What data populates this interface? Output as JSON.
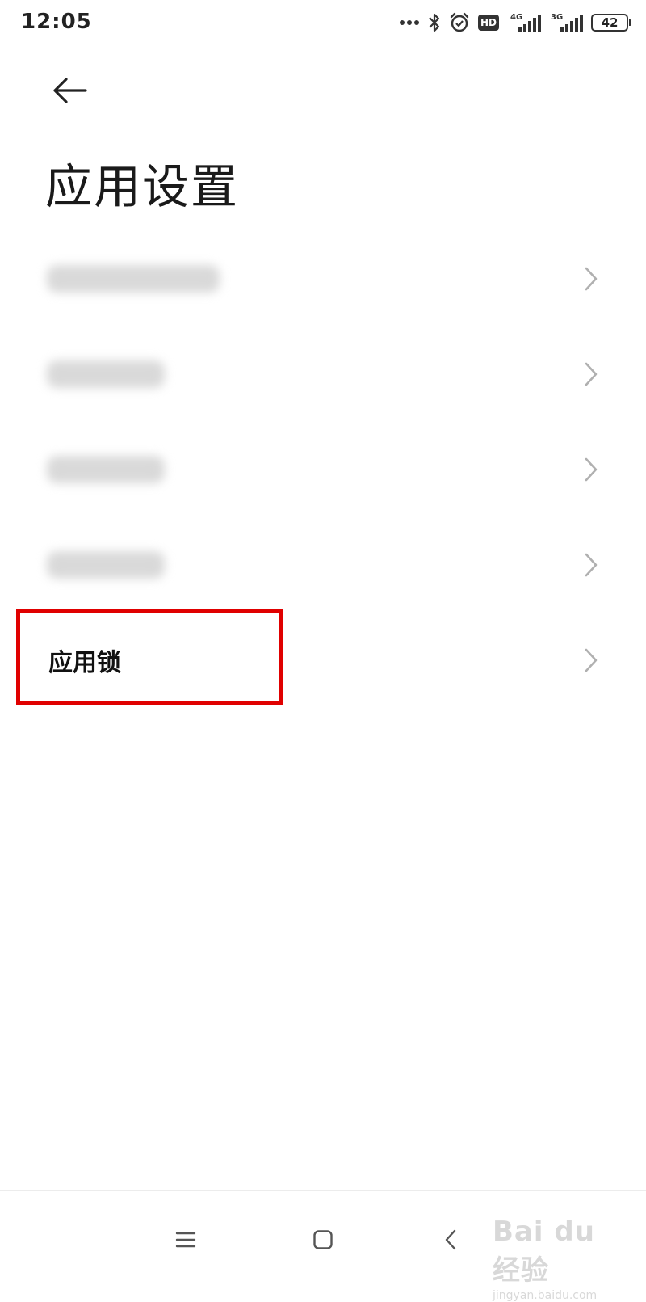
{
  "status_bar": {
    "time": "12:05",
    "network_4g": "4G",
    "network_3g": "3G",
    "hd": "HD",
    "battery": "42",
    "icons": [
      "more-dots-icon",
      "bluetooth-icon",
      "alarm-icon",
      "hd-icon",
      "signal-4g-icon",
      "signal-3g-icon",
      "battery-icon"
    ]
  },
  "header": {
    "title": "应用设置",
    "back_icon": "arrow-left-icon"
  },
  "settings": {
    "items": [
      {
        "label": "",
        "blurred": true
      },
      {
        "label": "",
        "blurred": true
      },
      {
        "label": "",
        "blurred": true
      },
      {
        "label": "",
        "blurred": true
      },
      {
        "label": "应用锁",
        "blurred": false,
        "highlighted": true
      }
    ]
  },
  "nav_bar": {
    "icons": [
      "menu-icon",
      "home-icon",
      "back-icon"
    ]
  },
  "watermark": {
    "main": "Bai du 经验",
    "sub": "jingyan.baidu.com"
  },
  "colors": {
    "highlight": "#e00000",
    "chevron": "#b0b0b0",
    "text": "#111111"
  }
}
